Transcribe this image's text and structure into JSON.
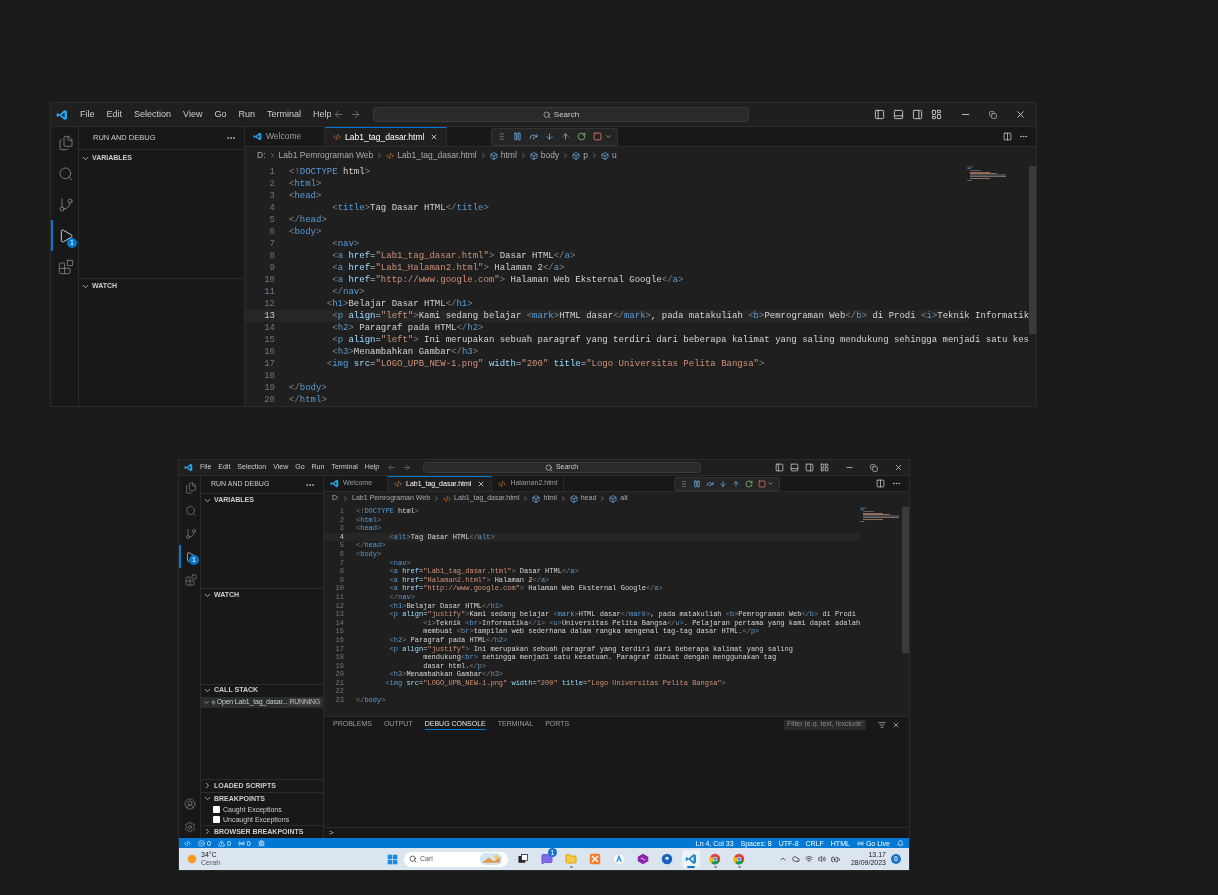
{
  "windows": [
    {
      "menu": [
        "File",
        "Edit",
        "Selection",
        "View",
        "Go",
        "Run",
        "Terminal",
        "Help"
      ],
      "search": "Search",
      "activity": [
        {
          "kind": "explorer",
          "selected": false
        },
        {
          "kind": "search",
          "selected": false
        },
        {
          "kind": "source-control",
          "selected": false
        },
        {
          "kind": "run-debug",
          "selected": true,
          "badge": "1"
        },
        {
          "kind": "extensions",
          "selected": false
        }
      ],
      "sidebar": {
        "title": "RUN AND DEBUG",
        "sections": [
          {
            "title": "VARIABLES",
            "expanded": true
          },
          {
            "title": "WATCH",
            "expanded": true
          }
        ]
      },
      "tabs": [
        {
          "label": "Welcome",
          "kind": "welcome",
          "selected": false
        },
        {
          "label": "Lab1_tag_dasar.html",
          "kind": "html",
          "selected": true
        }
      ],
      "breadcrumbs": [
        {
          "label": "D:",
          "kind": "text"
        },
        {
          "label": "Lab1 Pemrograman Web",
          "kind": "text"
        },
        {
          "label": "Lab1_tag_dasar.html",
          "kind": "file"
        },
        {
          "label": "html",
          "kind": "element"
        },
        {
          "label": "body",
          "kind": "element"
        },
        {
          "label": "p",
          "kind": "element"
        },
        {
          "label": "u",
          "kind": "element"
        }
      ],
      "lines": [
        {
          "number": "1",
          "code": "<!DOCTYPE html>",
          "current": false
        },
        {
          "number": "2",
          "code": "<html>",
          "current": false
        },
        {
          "number": "3",
          "code": "<head>",
          "current": false
        },
        {
          "number": "4",
          "code": "        <title>Tag Dasar HTML</title>",
          "current": false
        },
        {
          "number": "5",
          "code": "</head>",
          "current": false
        },
        {
          "number": "6",
          "code": "<body>",
          "current": false
        },
        {
          "number": "7",
          "code": "        <nav>",
          "current": false
        },
        {
          "number": "8",
          "code": "        <a href=\"Lab1_tag_dasar.html\"> Dasar HTML</a>",
          "current": false
        },
        {
          "number": "9",
          "code": "        <a href=\"Lab1_Halaman2.html\"> Halaman 2</a>",
          "current": false
        },
        {
          "number": "10",
          "code": "        <a href=\"http://www.google.com\"> Halaman Web Eksternal Google</a>",
          "current": false
        },
        {
          "number": "11",
          "code": "        </nav>",
          "current": false
        },
        {
          "number": "12",
          "code": "       <h1>Belajar Dasar HTML</h1>",
          "current": false
        },
        {
          "number": "13",
          "code": "        <p align=\"left\">Kami sedang belajar <mark>HTML dasar</mark>, pada matakuliah <b>Pemrograman Web</b> di Prodi <i>Teknik Informatik",
          "current": true
        },
        {
          "number": "14",
          "code": "        <h2> Paragraf pada HTML</h2>",
          "current": false
        },
        {
          "number": "15",
          "code": "        <p align=\"left\"> Ini merupakan sebuah paragraf yang terdiri dari beberapa kalimat yang saling mendukung sehingga menjadi satu kes",
          "current": false
        },
        {
          "number": "16",
          "code": "        <h3>Menambahkan Gambar</h3>",
          "current": false
        },
        {
          "number": "17",
          "code": "       <img src=\"LOGO_UPB_NEW-1.png\" width=\"200\" title=\"Logo Universitas Pelita Bangsa\">",
          "current": false
        },
        {
          "number": "18",
          "current": false
        },
        {
          "number": "19",
          "code": "</body>",
          "current": false
        },
        {
          "number": "20",
          "code": "</html>",
          "current": false
        }
      ]
    },
    {
      "menu": [
        "File",
        "Edit",
        "Selection",
        "View",
        "Go",
        "Run",
        "Terminal",
        "Help"
      ],
      "search": "Search",
      "activity": [
        {
          "kind": "explorer",
          "selected": false
        },
        {
          "kind": "search",
          "selected": false
        },
        {
          "kind": "source-control",
          "selected": false
        },
        {
          "kind": "run-debug",
          "selected": true,
          "badge": "1"
        },
        {
          "kind": "extensions",
          "selected": false
        }
      ],
      "activity_bottom": [
        {
          "kind": "account"
        },
        {
          "kind": "settings"
        }
      ],
      "sidebar": {
        "title": "RUN AND DEBUG",
        "sections": [
          {
            "title": "VARIABLES",
            "expanded": true
          },
          {
            "title": "WATCH",
            "expanded": true
          },
          {
            "title": "CALL STACK",
            "expanded": true,
            "items": [
              {
                "kind": "session",
                "label": "Open Lab1_tag_dasar...",
                "badge": "RUNNING",
                "expanded": true
              }
            ]
          },
          {
            "title": "LOADED SCRIPTS",
            "expanded": false
          },
          {
            "title": "BREAKPOINTS",
            "expanded": true,
            "items": [
              {
                "kind": "checkbox",
                "label": "Caught Exceptions",
                "checked": false
              },
              {
                "kind": "checkbox",
                "label": "Uncaught Exceptions",
                "checked": false
              }
            ]
          },
          {
            "title": "BROWSER BREAKPOINTS",
            "expanded": false
          }
        ]
      },
      "tabs": [
        {
          "label": "Welcome",
          "kind": "welcome",
          "selected": false
        },
        {
          "label": "Lab1_tag_dasar.html",
          "kind": "html",
          "selected": true
        },
        {
          "label": "Halaman2.html",
          "kind": "html",
          "selected": false
        }
      ],
      "breadcrumbs": [
        {
          "label": "D:",
          "kind": "text"
        },
        {
          "label": "Lab1 Pemrograman Web",
          "kind": "text"
        },
        {
          "label": "Lab1_tag_dasar.html",
          "kind": "file"
        },
        {
          "label": "html",
          "kind": "element"
        },
        {
          "label": "head",
          "kind": "element"
        },
        {
          "label": "alt",
          "kind": "element"
        }
      ],
      "lines": [
        {
          "number": "1",
          "code": "<!DOCTYPE html>",
          "current": false
        },
        {
          "number": "2",
          "code": "<html>",
          "current": false
        },
        {
          "number": "3",
          "code": "<head>",
          "current": false
        },
        {
          "number": "4",
          "code": "        <alt>Tag Dasar HTML</alt>",
          "current": true
        },
        {
          "number": "5",
          "code": "</head>",
          "current": false
        },
        {
          "number": "6",
          "code": "<body>",
          "current": false
        },
        {
          "number": "7",
          "code": "        <nav>",
          "current": false
        },
        {
          "number": "8",
          "code": "        <a href=\"Lab1_tag_dasar.html\"> Dasar HTML</a>",
          "current": false
        },
        {
          "number": "9",
          "code": "        <a href=\"Halaman2.html\"> Halaman 2</a>",
          "current": false
        },
        {
          "number": "10",
          "code": "        <a href=\"http://www.google.com\"> Halaman Web Eksternal Google</a>",
          "current": false
        },
        {
          "number": "11",
          "code": "        </nav>",
          "current": false
        },
        {
          "number": "12",
          "code": "        <h1>Belajar Dasar HTML</h1>",
          "current": false
        },
        {
          "number": "13",
          "code": "        <p align=\"justify\">Kami sedang belajar <mark>HTML dasar</mark>, pada matakuliah <b>Pemrograman Web</b> di Prodi",
          "current": false
        },
        {
          "number": "14",
          "code": "                <i>Teknik <br>Informatika</i> <u>Universitas Pelita Bangsa</u>. Pelajaran pertama yang kami dapat adalah",
          "current": false
        },
        {
          "number": "15",
          "code": "                membuat <br>tampilan web sederhana dalam rangka mengenal tag-tag dasar HTML.</p>",
          "current": false
        },
        {
          "number": "16",
          "code": "        <h2> Paragraf pada HTML</h2>",
          "current": false
        },
        {
          "number": "17",
          "code": "        <p align=\"justify\"> Ini merupakan sebuah paragraf yang terdiri dari beberapa kalimat yang saling",
          "current": false
        },
        {
          "number": "18",
          "code": "                mendukung<br> sehingga menjadi satu kesatuan. Paragraf dibuat dengan menggunakan tag",
          "current": false
        },
        {
          "number": "19",
          "code": "                dasar html.</p>",
          "current": false
        },
        {
          "number": "20",
          "code": "        <h3>Menambahkan Gambar</h3>",
          "current": false
        },
        {
          "number": "21",
          "code": "       <img src=\"LOGO_UPB_NEW-1.png\" width=\"200\" title=\"Logo Universitas Pelita Bangsa\">",
          "current": false
        },
        {
          "number": "22",
          "current": false
        },
        {
          "number": "23",
          "code": "</body>",
          "current": false
        }
      ],
      "panel": {
        "tabs": [
          {
            "label": "PROBLEMS",
            "selected": false
          },
          {
            "label": "OUTPUT",
            "selected": false
          },
          {
            "label": "DEBUG CONSOLE",
            "selected": true
          },
          {
            "label": "TERMINAL",
            "selected": false
          },
          {
            "label": "PORTS",
            "selected": false
          }
        ],
        "filter_placeholder": "Filter (e.g. text, !exclude)",
        "prompt": ">"
      },
      "status_bar": {
        "left": [
          {
            "kind": "remote"
          },
          {
            "kind": "errors",
            "label": "0"
          },
          {
            "kind": "warnings",
            "label": "0"
          },
          {
            "kind": "ports",
            "label": "0"
          },
          {
            "kind": "debug"
          }
        ],
        "right": [
          {
            "kind": "text",
            "label": "Ln 4, Col 33"
          },
          {
            "kind": "text",
            "label": "Spaces: 8"
          },
          {
            "kind": "text",
            "label": "UTF-8"
          },
          {
            "kind": "text",
            "label": "CRLF"
          },
          {
            "kind": "text",
            "label": "HTML"
          },
          {
            "kind": "live",
            "label": "Go Live"
          },
          {
            "kind": "bell"
          }
        ]
      },
      "taskbar": {
        "weather": {
          "temperature": "34°C",
          "condition": "Cerah"
        },
        "search_placeholder": "Cari",
        "apps": [
          {
            "kind": "task-view",
            "running": false,
            "selected": false
          },
          {
            "kind": "chat",
            "running": false,
            "selected": false,
            "badge": "1"
          },
          {
            "kind": "folder",
            "running": true,
            "selected": false
          },
          {
            "kind": "xampp",
            "running": false,
            "selected": false
          },
          {
            "kind": "store",
            "running": false,
            "selected": false
          },
          {
            "kind": "studio",
            "running": false,
            "selected": false
          },
          {
            "kind": "maps",
            "running": false,
            "selected": false
          },
          {
            "kind": "vscode",
            "running": true,
            "selected": true
          },
          {
            "kind": "chrome",
            "running": true,
            "selected": false
          },
          {
            "kind": "chrome",
            "running": true,
            "selected": false
          }
        ],
        "time": "13.17",
        "date": "28/09/2023",
        "notifications": "6"
      }
    }
  ]
}
